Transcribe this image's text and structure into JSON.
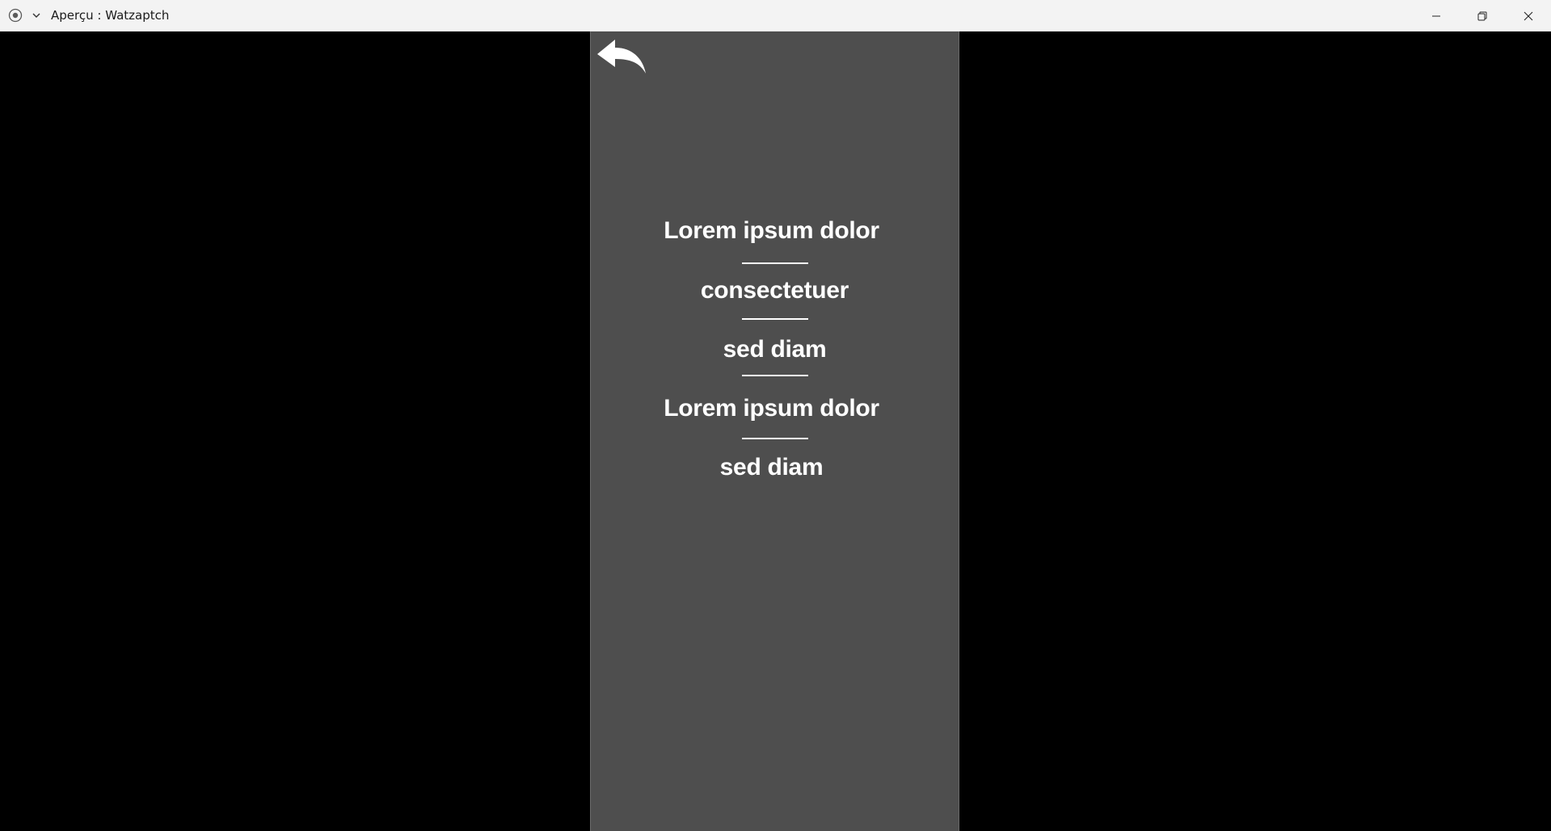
{
  "window": {
    "title": "Aperçu : Watzaptch",
    "app_icon": "record-icon",
    "menu_icon": "chevron-down-icon",
    "controls": {
      "minimize_icon": "minimize-icon",
      "maximize_icon": "restore-icon",
      "close_icon": "close-icon"
    }
  },
  "panel": {
    "background": "#4e4e4e",
    "back_icon": "back-arrow-icon",
    "menu_items": [
      "Lorem ipsum dolor",
      "consectetuer",
      "sed diam",
      "Lorem ipsum dolor",
      "sed diam"
    ]
  }
}
